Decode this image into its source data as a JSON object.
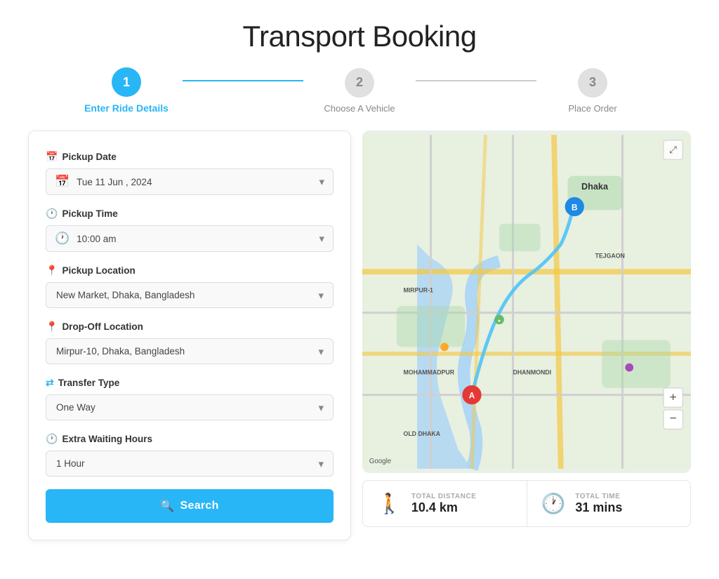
{
  "title": "Transport Booking",
  "stepper": {
    "steps": [
      {
        "number": "1",
        "label": "Enter Ride Details",
        "active": true
      },
      {
        "number": "2",
        "label": "Choose A Vehicle",
        "active": false
      },
      {
        "number": "3",
        "label": "Place Order",
        "active": false
      }
    ]
  },
  "form": {
    "pickup_date_label": "Pickup Date",
    "pickup_date_value": "Tue 11 Jun , 2024",
    "pickup_time_label": "Pickup Time",
    "pickup_time_value": "10:00 am",
    "pickup_location_label": "Pickup Location",
    "pickup_location_value": "New Market, Dhaka, Bangladesh",
    "dropoff_location_label": "Drop-Off Location",
    "dropoff_location_value": "Mirpur-10, Dhaka, Bangladesh",
    "transfer_type_label": "Transfer Type",
    "transfer_type_value": "One Way",
    "waiting_hours_label": "Extra Waiting Hours",
    "waiting_hours_value": "1 Hour",
    "search_button_label": "Search"
  },
  "map": {
    "fullscreen_icon": "⤢"
  },
  "info_bar": {
    "distance_label": "TOTAL DISTANCE",
    "distance_value": "10.4 km",
    "time_label": "TOTAL TIME",
    "time_value": "31 mins"
  }
}
